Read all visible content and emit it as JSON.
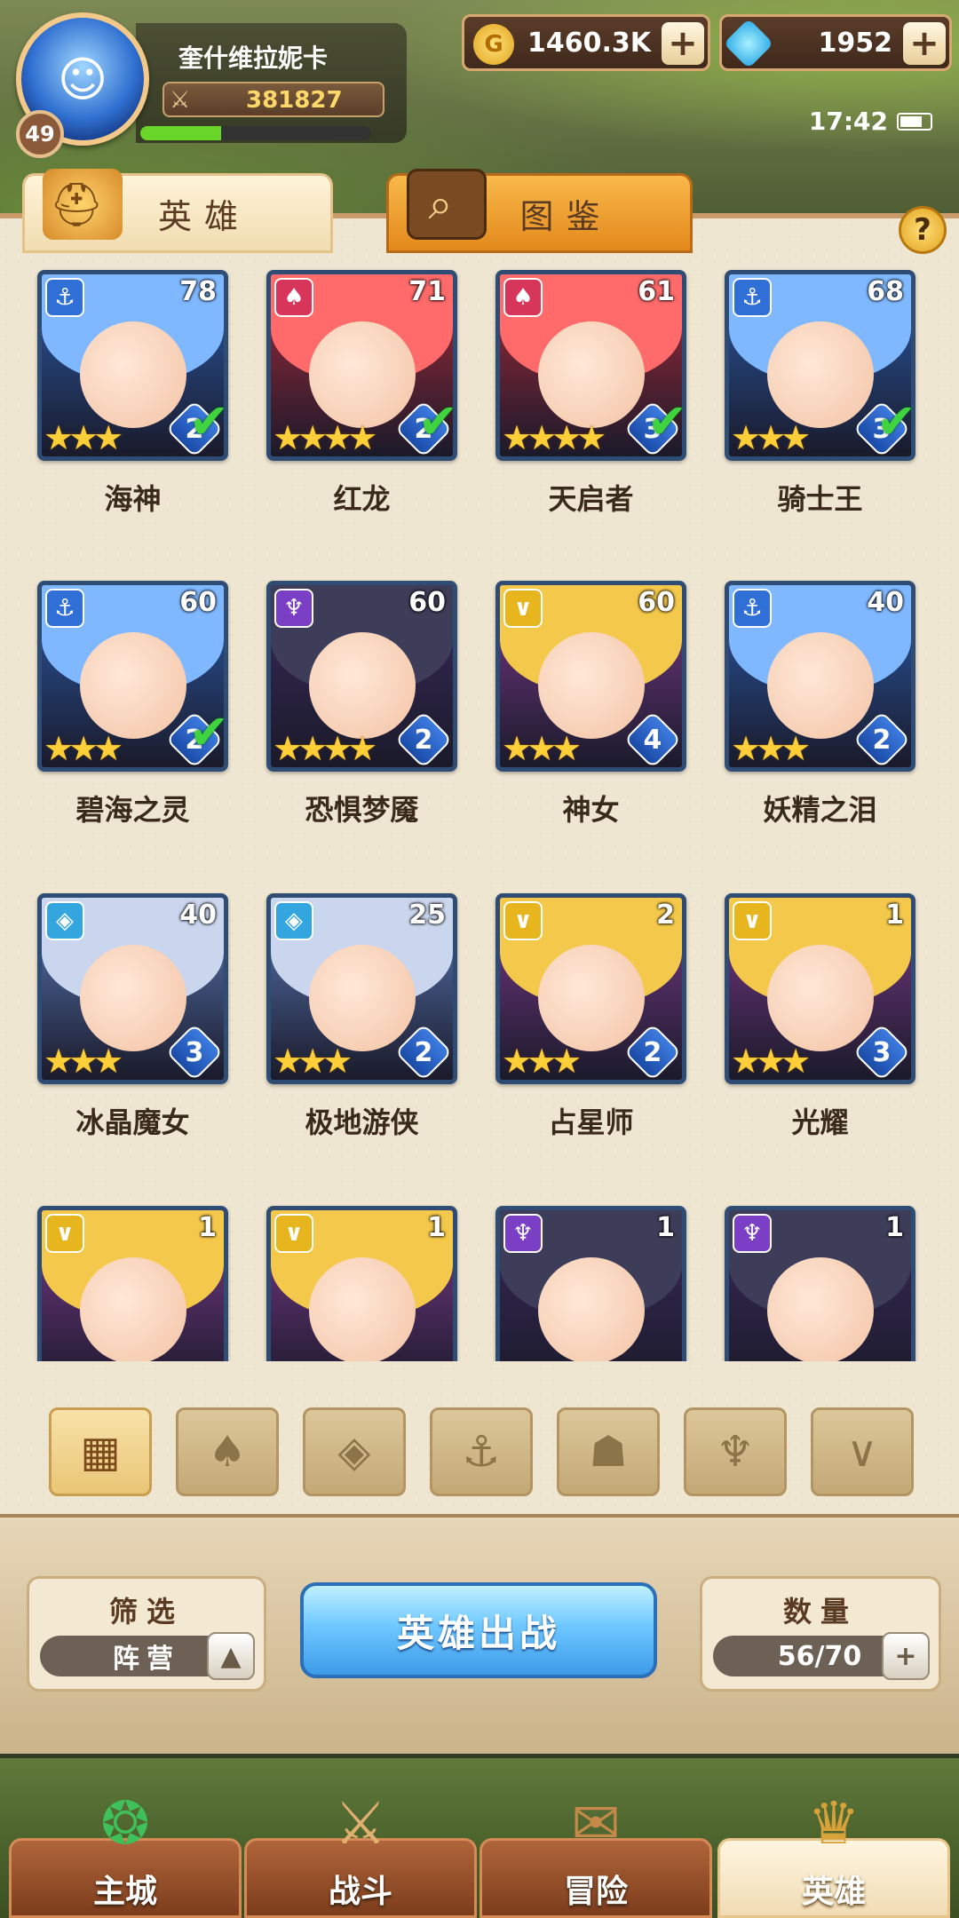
{
  "header": {
    "player_name": "奎什维拉妮卡",
    "player_level": "49",
    "power": "381827",
    "exp_fraction": 0.35,
    "gold": "1460.3K",
    "gems": "1952",
    "time": "17:42"
  },
  "tabs": [
    {
      "label": "英雄",
      "active": true
    },
    {
      "label": "图鉴",
      "active": false
    }
  ],
  "help_label": "?",
  "heroes": [
    {
      "name": "海神",
      "level": "78",
      "faction": "water",
      "stars": 3,
      "rank": "2",
      "check": true
    },
    {
      "name": "红龙",
      "level": "71",
      "faction": "fire",
      "stars": 4,
      "rank": "2",
      "check": true
    },
    {
      "name": "天启者",
      "level": "61",
      "faction": "fire",
      "stars": 4,
      "rank": "3",
      "check": true
    },
    {
      "name": "骑士王",
      "level": "68",
      "faction": "water",
      "stars": 3,
      "rank": "3",
      "check": true
    },
    {
      "name": "碧海之灵",
      "level": "60",
      "faction": "water",
      "stars": 3,
      "rank": "2",
      "check": true
    },
    {
      "name": "恐惧梦魇",
      "level": "60",
      "faction": "dark",
      "stars": 4,
      "rank": "2",
      "check": false
    },
    {
      "name": "神女",
      "level": "60",
      "faction": "light",
      "stars": 3,
      "rank": "4",
      "check": false
    },
    {
      "name": "妖精之泪",
      "level": "40",
      "faction": "water",
      "stars": 3,
      "rank": "2",
      "check": false
    },
    {
      "name": "冰晶魔女",
      "level": "40",
      "faction": "ice",
      "stars": 3,
      "rank": "3",
      "check": false
    },
    {
      "name": "极地游侠",
      "level": "25",
      "faction": "ice",
      "stars": 3,
      "rank": "2",
      "check": false
    },
    {
      "name": "占星师",
      "level": "2",
      "faction": "light",
      "stars": 3,
      "rank": "2",
      "check": false
    },
    {
      "name": "光耀",
      "level": "1",
      "faction": "light",
      "stars": 3,
      "rank": "3",
      "check": false
    },
    {
      "name": "",
      "level": "1",
      "faction": "light",
      "stars": 0,
      "rank": "",
      "check": false
    },
    {
      "name": "",
      "level": "1",
      "faction": "light",
      "stars": 0,
      "rank": "",
      "check": false
    },
    {
      "name": "",
      "level": "1",
      "faction": "dark",
      "stars": 0,
      "rank": "",
      "check": false
    },
    {
      "name": "",
      "level": "1",
      "faction": "dark",
      "stars": 0,
      "rank": "",
      "check": false
    }
  ],
  "filters": [
    {
      "icon": "all-grid-icon",
      "active": true
    },
    {
      "icon": "fire-faction-icon",
      "active": false
    },
    {
      "icon": "ice-faction-icon",
      "active": false
    },
    {
      "icon": "water-faction-icon",
      "active": false
    },
    {
      "icon": "beast-faction-icon",
      "active": false
    },
    {
      "icon": "dark-faction-icon",
      "active": false
    },
    {
      "icon": "light-faction-icon",
      "active": false
    }
  ],
  "filter_box": {
    "title": "筛选",
    "value": "阵营"
  },
  "deploy_button": "英雄出战",
  "count_box": {
    "title": "数量",
    "value": "56/70"
  },
  "nav": [
    {
      "label": "主城",
      "active": false
    },
    {
      "label": "战斗",
      "active": false
    },
    {
      "label": "冒险",
      "active": false
    },
    {
      "label": "英雄",
      "active": true
    }
  ]
}
